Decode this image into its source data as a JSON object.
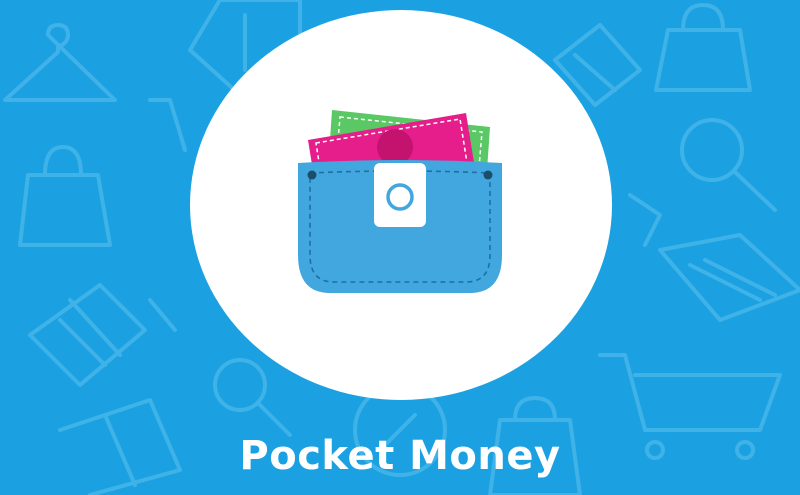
{
  "brand": {
    "name": "Pocket Money"
  },
  "colors": {
    "background": "#1ba1e2",
    "pattern_stroke": "#3fb3ea",
    "circle": "#ffffff",
    "wallet_blue": "#42a7de",
    "wallet_tab": "#ffffff",
    "note_green": "#5ac864",
    "note_pink": "#e61e8c"
  },
  "icons": {
    "logo": "wallet-with-notes-icon",
    "background_pattern": [
      "hanger-icon",
      "shopping-bag-icon",
      "tag-icon",
      "magnifier-icon",
      "shopping-cart-icon",
      "laptop-icon",
      "gift-icon",
      "percent-badge-icon"
    ]
  }
}
